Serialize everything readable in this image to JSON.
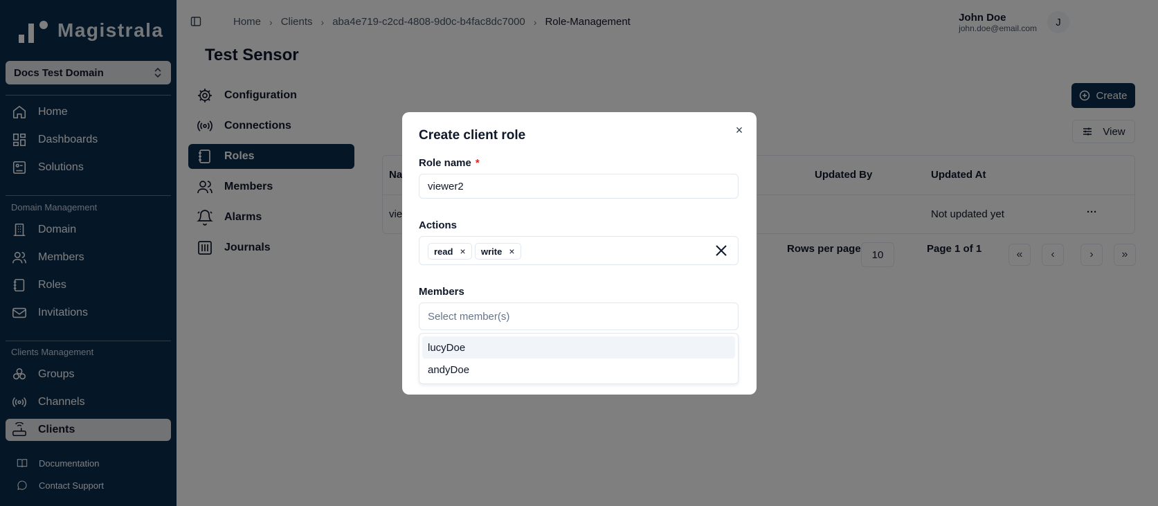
{
  "app": {
    "name": "Magistrala"
  },
  "domain_selector": {
    "value": "Docs Test Domain"
  },
  "sidebar": {
    "main": [
      {
        "label": "Home",
        "icon": "home-icon"
      },
      {
        "label": "Dashboards",
        "icon": "dashboard-icon"
      },
      {
        "label": "Solutions",
        "icon": "solutions-icon"
      }
    ],
    "domain_management_label": "Domain Management",
    "domain_management": [
      {
        "label": "Domain",
        "icon": "building-icon"
      },
      {
        "label": "Members",
        "icon": "users-icon"
      },
      {
        "label": "Roles",
        "icon": "notebook-icon"
      },
      {
        "label": "Invitations",
        "icon": "mail-icon"
      }
    ],
    "clients_management_label": "Clients Management",
    "clients_management": [
      {
        "label": "Groups",
        "icon": "groups-icon"
      },
      {
        "label": "Channels",
        "icon": "radio-icon"
      },
      {
        "label": "Clients",
        "icon": "router-icon",
        "active": true
      }
    ],
    "footer": [
      {
        "label": "Documentation",
        "icon": "book-icon"
      },
      {
        "label": "Contact Support",
        "icon": "chat-icon"
      }
    ]
  },
  "header": {
    "breadcrumbs": [
      "Home",
      "Clients",
      "aba4e719-c2cd-4808-9d0c-b4fac8dc7000",
      "Role-Management"
    ],
    "user": {
      "name": "John Doe",
      "email": "john.doe@email.com",
      "initial": "J"
    }
  },
  "page": {
    "title": "Test Sensor"
  },
  "subnav": [
    {
      "label": "Configuration",
      "icon": "gear-icon"
    },
    {
      "label": "Connections",
      "icon": "radio-icon"
    },
    {
      "label": "Roles",
      "icon": "notebook-icon",
      "active": true
    },
    {
      "label": "Members",
      "icon": "users-icon"
    },
    {
      "label": "Alarms",
      "icon": "bell-icon"
    },
    {
      "label": "Journals",
      "icon": "journal-icon"
    }
  ],
  "content": {
    "create_label": "Create",
    "view_label": "View",
    "table": {
      "headers": [
        "Na",
        "Updated By",
        "Updated At"
      ],
      "rows": [
        {
          "name": "vie",
          "updated_at": "Not updated yet",
          "actions": "···"
        }
      ]
    },
    "pagination": {
      "rows_per_page_label": "Rows per page",
      "rows_per_page_value": "10",
      "page_label": "Page 1 of 1",
      "first": "«",
      "prev": "‹",
      "next": "›",
      "last": "»"
    }
  },
  "modal": {
    "title": "Create client role",
    "close": "×",
    "role_name_label": "Role name",
    "required_marker": "*",
    "role_name_value": "viewer2",
    "actions_label": "Actions",
    "actions": [
      "read",
      "write"
    ],
    "tag_remove": "×",
    "members_label": "Members",
    "members_placeholder": "Select member(s)",
    "member_options": [
      "lucyDoe",
      "andyDoe"
    ]
  },
  "colors": {
    "sidebar": "#0b2d4f",
    "active_bg": "#e5e7eb",
    "required": "#dc2626"
  }
}
